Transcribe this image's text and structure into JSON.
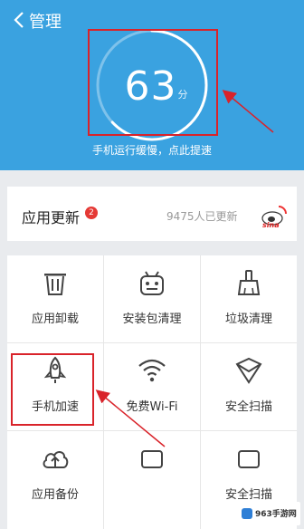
{
  "header": {
    "back_icon": "chevron-left-icon",
    "title": "管理",
    "score": "63",
    "score_unit": "分",
    "score_level": 0.63,
    "hint": "手机运行缓慢，点此提速",
    "bg_color": "#3aa2e0"
  },
  "update": {
    "label": "应用更新",
    "badge": "2",
    "stat": "9475人已更新",
    "logo_text": "sina"
  },
  "tools": [
    {
      "label": "应用卸载",
      "icon": "trash-icon"
    },
    {
      "label": "安装包清理",
      "icon": "android-icon"
    },
    {
      "label": "垃圾清理",
      "icon": "broom-icon"
    },
    {
      "label": "手机加速",
      "icon": "rocket-icon"
    },
    {
      "label": "免费Wi-Fi",
      "icon": "wifi-icon"
    },
    {
      "label": "安全扫描",
      "icon": "shield-icon"
    },
    {
      "label": "应用备份",
      "icon": "cloud-upload-icon"
    },
    {
      "label": "",
      "icon": "partial-icon"
    },
    {
      "label": "安全扫描",
      "icon": "partial-icon"
    }
  ],
  "watermark": {
    "text": "963手游网"
  },
  "annotation_color": "#d9232a"
}
